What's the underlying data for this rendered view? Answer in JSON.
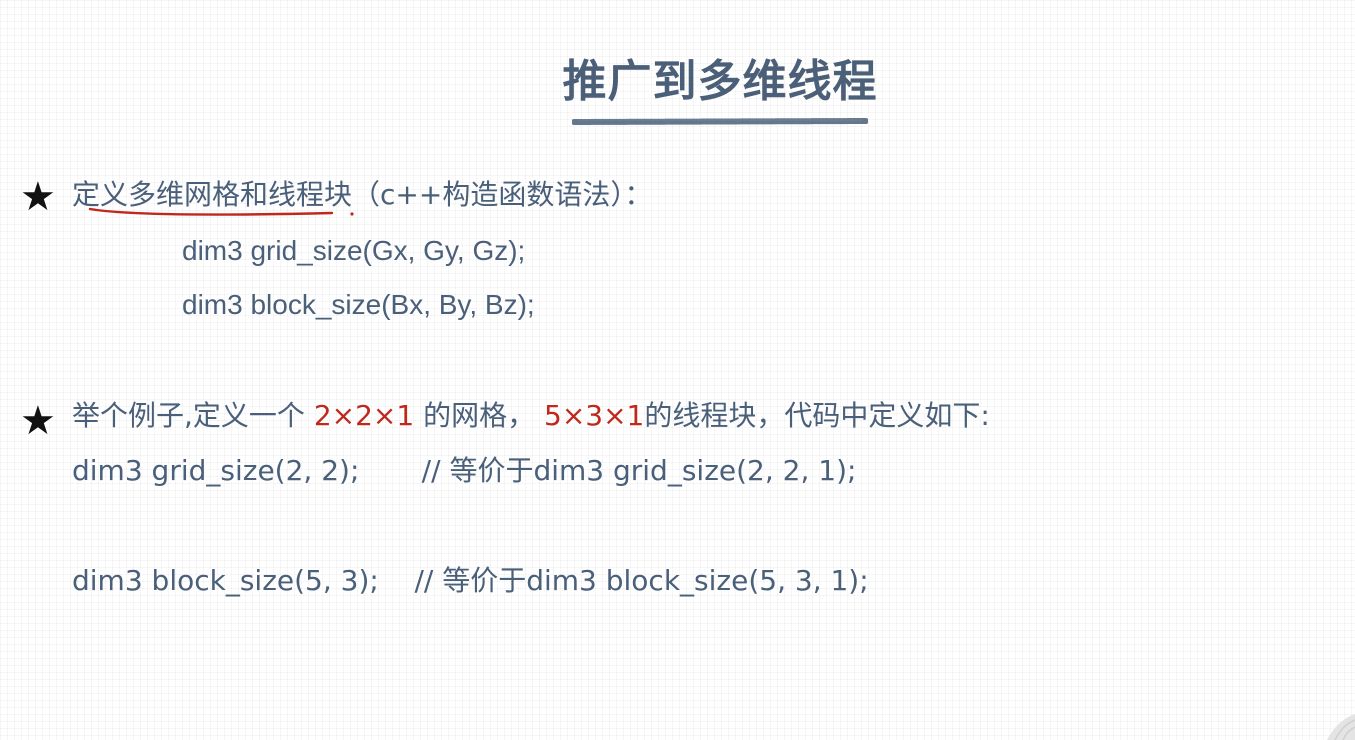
{
  "slide": {
    "title": "推广到多维线程"
  },
  "section1": {
    "bullet_glyph": "★",
    "heading": "定义多维网格和线程块",
    "heading_suffix": "（c++构造函数语法）：",
    "code_line1": "dim3 grid_size(Gx, Gy, Gz);",
    "code_line2": "dim3 block_size(Bx, By, Bz);"
  },
  "section2": {
    "bullet_glyph": "★",
    "intro_prefix": "举个例子,定义一个 ",
    "grid_dims": "2×2×1",
    "intro_mid": " 的网格， ",
    "block_dims": "5×3×1",
    "intro_suffix": "的线程块，代码中定义如下:",
    "code_line1": "dim3 grid_size(2, 2);       // 等价于dim3 grid_size(2, 2, 1);",
    "code_line2": "dim3 block_size(5, 3);    // 等价于dim3 block_size(5, 3, 1);"
  },
  "colors": {
    "text": "#4a5f7a",
    "title": "#4b6078",
    "highlight_red": "#c0281e",
    "annotation_red": "#c0281e",
    "star": "#111111"
  }
}
